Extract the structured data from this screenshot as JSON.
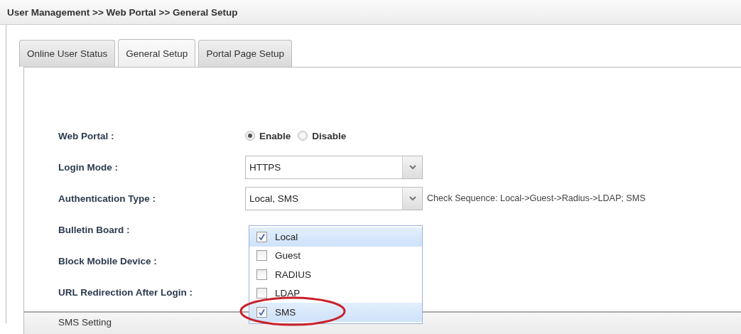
{
  "breadcrumb": "User Management >> Web Portal >> General Setup",
  "tabs": [
    {
      "label": "Online User Status",
      "selected": false
    },
    {
      "label": "General Setup",
      "selected": true
    },
    {
      "label": "Portal Page Setup",
      "selected": false
    }
  ],
  "form": [
    {
      "kind": "radio",
      "label": "Web Portal :",
      "options": [
        {
          "label": "Enable",
          "selected": true
        },
        {
          "label": "Disable",
          "selected": false
        }
      ]
    },
    {
      "kind": "select",
      "label": "Login Mode :",
      "value": "HTTPS"
    },
    {
      "kind": "select",
      "label": "Authentication Type :",
      "value": "Local, SMS",
      "note": "Check Sequence: Local->Guest->Radius->LDAP; SMS"
    },
    {
      "kind": "blank",
      "label": "Bulletin Board :"
    },
    {
      "kind": "blank",
      "label": "Block Mobile Device :"
    },
    {
      "kind": "blank",
      "label": "URL Redirection After Login :"
    }
  ],
  "dropdown": [
    {
      "label": "Local",
      "checked": true,
      "circled": false
    },
    {
      "label": "Guest",
      "checked": false,
      "circled": false
    },
    {
      "label": "RADIUS",
      "checked": false,
      "circled": false
    },
    {
      "label": "LDAP",
      "checked": false,
      "circled": false
    },
    {
      "label": "SMS",
      "checked": true,
      "circled": true
    }
  ],
  "section": {
    "title": "SMS Setting"
  }
}
